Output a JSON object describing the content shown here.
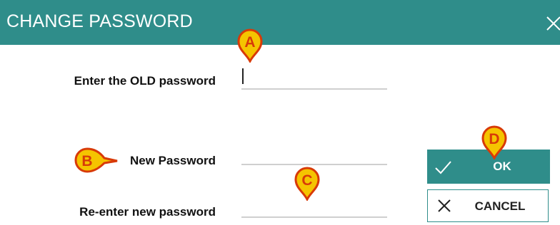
{
  "dialog": {
    "title": "CHANGE PASSWORD",
    "close_icon": "close-icon"
  },
  "form": {
    "old_password_label": "Enter the OLD password",
    "new_password_label": "New Password",
    "reenter_password_label": "Re-enter new password",
    "old_password_value": "",
    "new_password_value": "",
    "reenter_password_value": ""
  },
  "buttons": {
    "ok_label": "OK",
    "ok_icon": "checkmark-icon",
    "cancel_label": "CANCEL",
    "cancel_icon": "close-icon"
  },
  "markers": {
    "a": "A",
    "b": "B",
    "c": "C",
    "d": "D"
  },
  "colors": {
    "accent": "#2f8d8a",
    "marker_fill": "#f5c400",
    "marker_stroke": "#d83a08"
  }
}
